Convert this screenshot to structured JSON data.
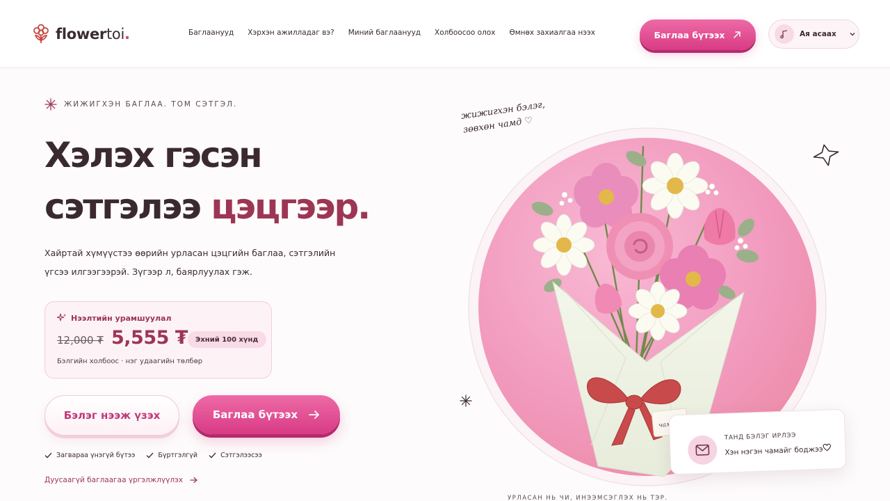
{
  "header": {
    "logo": {
      "main": "flower",
      "light": "toi",
      "dot": "."
    },
    "nav": [
      "Баглаанууд",
      "Хэрхэн ажилладаг вэ?",
      "Миний баглаанууд",
      "Холбоосоо олох",
      "Өмнөх захиалгаа нээх"
    ],
    "cta_label": "Баглаа бүтээх",
    "music_label": "Ая асаах"
  },
  "hero": {
    "eyebrow": "ЖИЖИГХЭН БАГЛАА. ТОМ СЭТГЭЛ.",
    "title_line1": "Хэлэх гэсэн",
    "title_line2_plain": "сэтгэлээ",
    "title_line2_accent": "цэцгээр.",
    "subtitle": "Хайртай хүмүүстээ өөрийн урласан цэцгийн баглаа, сэтгэлийн үгсээ илгээгээрэй. Зүгээр л, баярлуулах гэж.",
    "promo": {
      "title": "Нээлтийн урамшуулал",
      "old_price": "12,000 ₮",
      "new_price": "5,555 ₮",
      "badge": "Эхний 100 хүнд",
      "note": "Бэлгийн холбоос · нэг удаагийн төлбөр"
    },
    "btn_gift": "Бэлэг нээж үзэх",
    "btn_make": "Баглаа бүтээх",
    "checks": [
      "Загвараа үнэгүй бүтээ",
      "Бүртгэлгүй",
      "Сэтгэлээсээ"
    ],
    "link_more": "Дуусаагүй баглаагаа үргэлжлүүлэх"
  },
  "art": {
    "handnote_line1": "жижигхэн бэлэг,",
    "handnote_line2": "зөвхөн чамд ♡",
    "tag_label": "чамд ♡",
    "gift_card": {
      "kicker": "ТАНД БЭЛЭГ ИРЛЭЭ",
      "text": "Хэн нэгэн чамайг боджээ"
    },
    "footnote": "УРЛАСАН НЬ ЧИ, ИНЭЭМСЭГЛЭХ НЬ ТЭР."
  },
  "colors": {
    "accent_pink": "#d83b85",
    "accent_wine": "#9c3654",
    "circle_pink": "#f19ac0",
    "ink": "#3b2a30"
  }
}
